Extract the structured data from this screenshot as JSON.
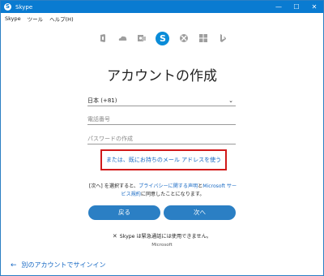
{
  "window": {
    "title": "Skype",
    "controls": {
      "minimize": "—",
      "maximize": "☐",
      "close": "✕"
    }
  },
  "menu": [
    "Skype",
    "ツール",
    "ヘルプ(H)"
  ],
  "brand_icons": [
    "office-icon",
    "onedrive-icon",
    "outlook-icon",
    "skype-icon",
    "xbox-icon",
    "windows-icon",
    "bing-icon"
  ],
  "heading": "アカウントの作成",
  "country_select": {
    "value": "日本 (+81)",
    "caret": "⌄"
  },
  "phone_field": {
    "placeholder": "電話番号"
  },
  "password_field": {
    "placeholder": "パスワードの作成"
  },
  "email_link": "または、既にお持ちのメール アドレスを使う",
  "terms": {
    "line1_pre": "[次へ] を選択すると、",
    "privacy_link": "プライバシーに関する声明",
    "mid": "と",
    "ms_link": "Microsoft サービス規約",
    "post": "に同意したことになります。"
  },
  "buttons": {
    "back": "戻る",
    "next": "次へ"
  },
  "emergency_note": "Skype は緊急通話には使用できません。",
  "footer_brand": "Microsoft",
  "signin_other": {
    "arrow": "←",
    "label": "別のアカウントでサインイン"
  },
  "colors": {
    "accent": "#0a7bd1",
    "button": "#2b7fc4",
    "link": "#1769c4",
    "highlight_box": "#d1191a"
  }
}
